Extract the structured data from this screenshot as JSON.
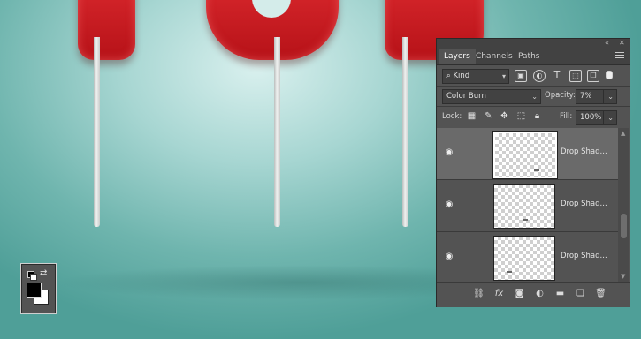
{
  "panel": {
    "tabs": [
      {
        "label": "Layers",
        "active": true
      },
      {
        "label": "Channels",
        "active": false
      },
      {
        "label": "Paths",
        "active": false
      }
    ],
    "filter": {
      "kind_label": "Kind"
    },
    "blend_mode": "Color Burn",
    "opacity": {
      "label": "Opacity:",
      "value": "7%"
    },
    "lock": {
      "label": "Lock:"
    },
    "fill": {
      "label": "Fill:",
      "value": "100%"
    },
    "layers": [
      {
        "name": "Drop Shad...",
        "selected": true
      },
      {
        "name": "Drop Shad...",
        "selected": false
      },
      {
        "name": "Drop Shad...",
        "selected": false
      }
    ],
    "footer": {
      "fx_label": "fx"
    }
  },
  "colors": {
    "foreground": "#000000",
    "background": "#ffffff",
    "candy": "#c8191f",
    "canvas_teal": "#6fb5ae"
  }
}
